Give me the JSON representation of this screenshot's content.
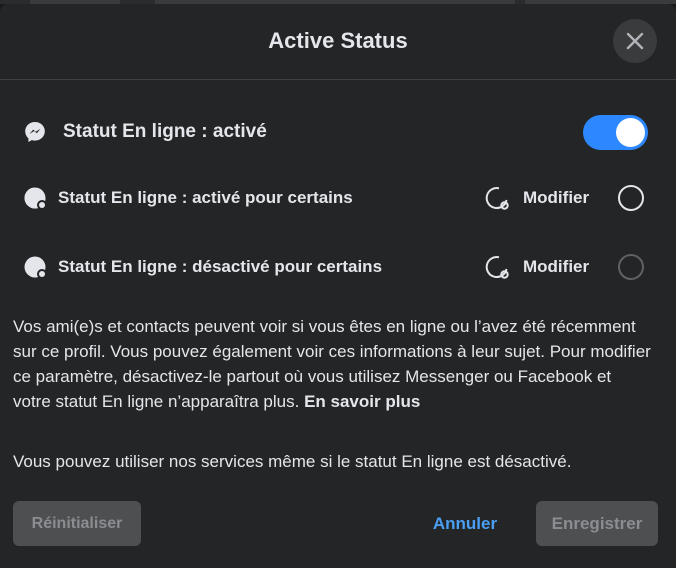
{
  "dialog": {
    "title": "Active Status",
    "close_icon": "close-icon"
  },
  "status_main": {
    "icon": "messenger-icon",
    "label": "Statut En ligne : activé",
    "toggle_on": true
  },
  "options": [
    {
      "icon": "active-status-dot-icon",
      "label": "Statut En ligne : activé pour certains",
      "edit_icon": "edit-circle-icon",
      "edit_label": "Modifier",
      "radio_enabled": true
    },
    {
      "icon": "active-status-dot-icon",
      "label": "Statut En ligne : désactivé pour certains",
      "edit_icon": "edit-circle-icon",
      "edit_label": "Modifier",
      "radio_enabled": false
    }
  ],
  "description": {
    "text": "Vos ami(e)s et contacts peuvent voir si vous êtes en ligne ou l’avez été récemment sur ce profil. Vous pouvez également voir ces informations à leur sujet. Pour modifier ce paramètre, désactivez-le partout où vous utilisez Messenger ou Facebook et votre statut En ligne n’apparaîtra plus.",
    "link": "En savoir plus",
    "note": "Vous pouvez utiliser nos services même si le statut En ligne est désactivé."
  },
  "footer": {
    "reset_label": "Réinitialiser",
    "cancel_label": "Annuler",
    "save_label": "Enregistrer"
  },
  "colors": {
    "background": "#242526",
    "accent": "#2d88ff",
    "link": "#4a9ff5",
    "text": "#e4e6eb",
    "disabled_button": "#4e4f50"
  }
}
